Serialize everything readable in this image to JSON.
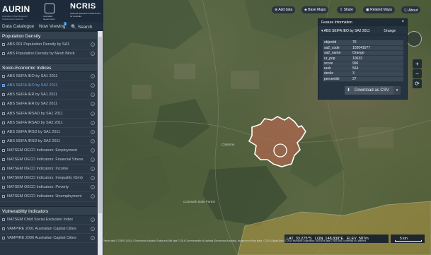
{
  "header": {
    "aurin_logo": "AURIN",
    "aurin_tagline": "Australian Urban Research Infrastructure Network",
    "gov_label": "Australian Government",
    "ncris_logo": "NCRIS",
    "ncris_tagline": "National Research Infrastructure for Australia"
  },
  "tabs": {
    "catalogue": "Data Catalogue",
    "now_viewing": "Now Viewing",
    "now_viewing_count": "1",
    "search": "Search"
  },
  "catalog": {
    "population_density": {
      "title": "Population Density",
      "items": [
        {
          "label": "ABS 001 Population Density by SA1"
        },
        {
          "label": "ABS Population Density by Mesh Block"
        }
      ]
    },
    "socio_economic": {
      "title": "Socio-Economic Indices",
      "items": [
        {
          "label": "ABS SEIFA IEO by SA1 2011"
        },
        {
          "label": "ABS SEIFA IEO by SA2 2011",
          "selected": true
        },
        {
          "label": "ABS SEIFA IER by SA1 2011"
        },
        {
          "label": "ABS SEIFA IER by SA2 2011"
        },
        {
          "label": "ABS SEIFA IRSAD by SA1 2011"
        },
        {
          "label": "ABS SEIFA IRSAD by SA2 2011"
        },
        {
          "label": "ABS SEIFA IRSD by SA1 2011"
        },
        {
          "label": "ABS SEIFA IRSD by SA2 2011"
        },
        {
          "label": "NATSEM OECD Indicators: Employment"
        },
        {
          "label": "NATSEM OECD Indicators: Financial Stress"
        },
        {
          "label": "NATSEM OECD Indicators: Income"
        },
        {
          "label": "NATSEM OECD Indicators: Inequality (Gini)"
        },
        {
          "label": "NATSEM OECD Indicators: Poverty"
        },
        {
          "label": "NATSEM OECD Indicators: Unemployment"
        }
      ]
    },
    "vulnerability": {
      "title": "Vulnerability Indicators",
      "items": [
        {
          "label": "NATSEM Child Social Exclusion Index"
        },
        {
          "label": "VAMPIRE 2001 Australian Capital Cities"
        },
        {
          "label": "VAMPIRE 2006 Australian Capital Cities"
        }
      ]
    }
  },
  "toolbar": {
    "add_data": "Add data",
    "base_maps": "Base Maps",
    "share": "Share",
    "related_maps": "Related Maps",
    "about": "About"
  },
  "feature_info": {
    "panel_title": "Feature Information",
    "layer_name": "ABS SEIFA IEO by SA2 2011",
    "place": "Orange",
    "rows": [
      {
        "key": "objectid",
        "value": "76"
      },
      {
        "key": "sa2_code",
        "value": "103041077"
      },
      {
        "key": "sa2_name",
        "value": "Orange"
      },
      {
        "key": "ur_pop",
        "value": "10633"
      },
      {
        "key": "score",
        "value": "996"
      },
      {
        "key": "rank",
        "value": "564"
      },
      {
        "key": "decile",
        "value": "3"
      },
      {
        "key": "percentile",
        "value": "27"
      }
    ],
    "download_label": "Download as CSV"
  },
  "map_labels": {
    "location_1": "Cumnock State Forest",
    "location_2": "Cabonne"
  },
  "status": {
    "lat_label": "LAT",
    "lat_value": "33.275°S",
    "lon_label": "LON",
    "lon_value": "148.839°E",
    "elev_label": "ELEV",
    "elev_value": "587m",
    "scale_label": "5 km"
  },
  "attribution": "Terrain data © CSIRO (2011) / Geoscience Australia. Roads and Rail data © 2014 Commonwealth of Australia (Geoscience Australia). Imagery from Bing Maps. © 2014 DigitalGlobe, © 2014 Microsoft Corporation. NATSEM data © NATSEM, University of Canberra."
}
